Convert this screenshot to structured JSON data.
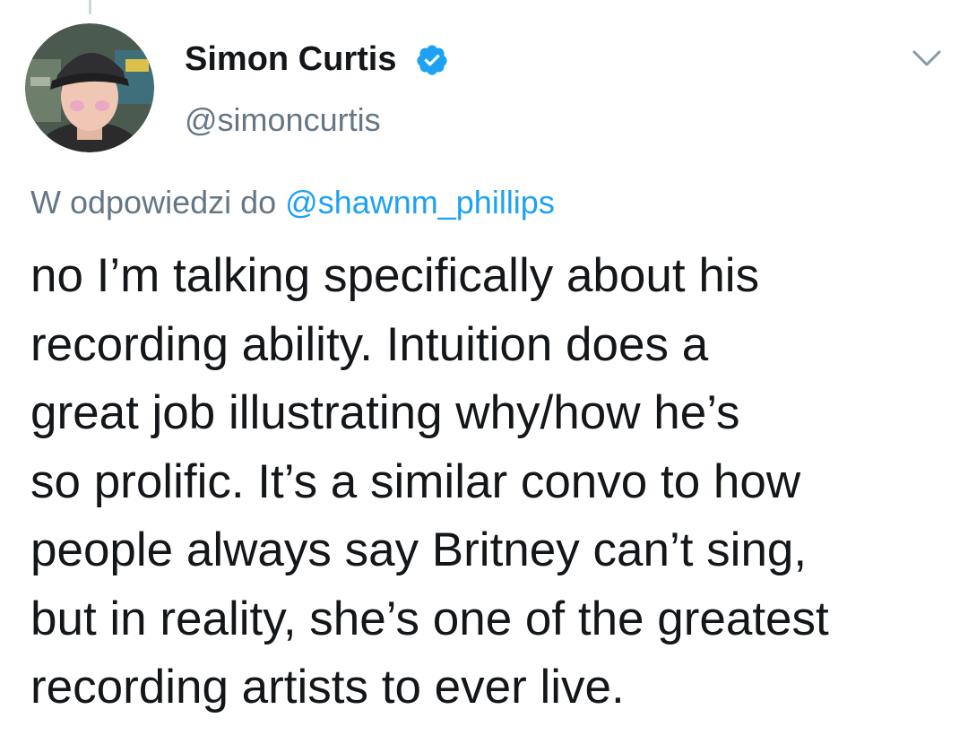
{
  "tweet": {
    "author": {
      "display_name": "Simon Curtis",
      "handle": "@simoncurtis",
      "verified": true,
      "verified_icon": "verified-badge-icon",
      "avatar_icon": "avatar-photo"
    },
    "menu_icon": "chevron-down-icon",
    "reply_context": {
      "prefix": "W odpowiedzi do ",
      "handle": "@shawnm_phillips"
    },
    "text_lines": [
      "no I’m talking specifically about his",
      "recording ability. Intuition does a",
      "great job illustrating why/how he’s",
      "so prolific. It’s a similar convo to how",
      "people always say Britney can’t sing,",
      "but in reality, she’s one of the greatest",
      "recording artists to ever live."
    ]
  },
  "colors": {
    "text_primary": "#14171a",
    "text_secondary": "#657786",
    "link": "#1da1f2",
    "verified": "#1da1f2",
    "thread_line": "#ccd6dd"
  }
}
